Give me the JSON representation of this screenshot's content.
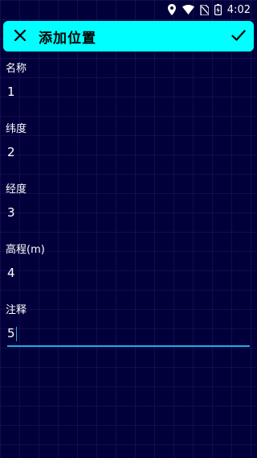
{
  "status_bar": {
    "time": "4:02",
    "icons": [
      "location-icon",
      "wifi-icon",
      "no-sim-icon",
      "battery-charging-icon"
    ]
  },
  "app_bar": {
    "title": "添加位置",
    "close_icon": "close-icon",
    "confirm_icon": "check-icon",
    "background": "#00ffff"
  },
  "form": {
    "fields": [
      {
        "label": "名称",
        "value": "1"
      },
      {
        "label": "纬度",
        "value": "2"
      },
      {
        "label": "经度",
        "value": "3"
      },
      {
        "label": "高程(m)",
        "value": "4"
      },
      {
        "label": "注释",
        "value": "5",
        "focused": true
      }
    ]
  },
  "colors": {
    "background": "#02003a",
    "accent": "#29a8e0",
    "app_bar": "#00ffff"
  }
}
